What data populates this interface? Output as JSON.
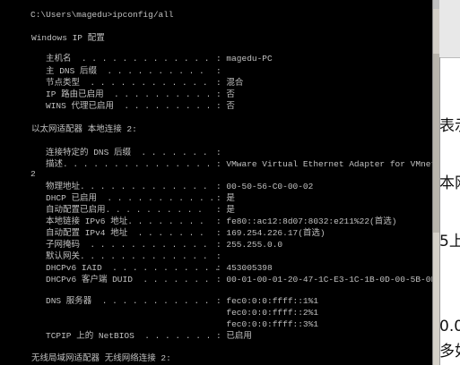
{
  "console": {
    "command_line": "C:\\Users\\magedu>ipconfig/all",
    "windows_ip_header": "Windows IP 配置",
    "host_rows": [
      {
        "key": "主机名  . . . . . . . . . . . . .",
        "value": ": magedu-PC"
      },
      {
        "key": "主 DNS 后缀  . . . . . . . . . .",
        "value": ":"
      },
      {
        "key": "节点类型  . . . . . . . . . . . .",
        "value": ": 混合"
      },
      {
        "key": "IP 路由已启用  . . . . . . . . . .",
        "value": ": 否"
      },
      {
        "key": "WINS 代理已启用  . . . . . . . . .",
        "value": ": 否"
      }
    ],
    "adapter1_header": "以太网适配器 本地连接 2:",
    "adapter1_rows": [
      {
        "key": "连接特定的 DNS 后缀  . . . . . . .",
        "value": ":"
      },
      {
        "key": "描述. . . . . . . . . . . . . . .",
        "value": ": VMware Virtual Ethernet Adapter for VMnet"
      },
      {
        "key": "物理地址. . . . . . . . . . . . .",
        "value": ": 00-50-56-C0-00-02"
      },
      {
        "key": "DHCP 已启用  . . . . . . . . . . .",
        "value": ": 是"
      },
      {
        "key": "自动配置已启用. . . . . . . . . .",
        "value": ": 是"
      },
      {
        "key": "本地链接 IPv6 地址. . . . . . . .",
        "value": ": fe80::ac12:8d07:8032:e211%22(首选)"
      },
      {
        "key": "自动配置 IPv4 地址  . . . . . . .",
        "value": ": 169.254.226.17(首选)"
      },
      {
        "key": "子网掩码  . . . . . . . . . . . .",
        "value": ": 255.255.0.0"
      },
      {
        "key": "默认网关. . . . . . . . . . . . .",
        "value": ":"
      },
      {
        "key": "DHCPv6 IAID  . . . . . . . . . . .",
        "value": ": 453005398"
      },
      {
        "key": "DHCPv6 客户端 DUID  . . . . . . .",
        "value": ": 00-01-00-01-20-47-1C-E3-1C-1B-0D-00-5B-0F"
      },
      {
        "key": "DNS 服务器  . . . . . . . . . . .",
        "value": ": fec0:0:0:ffff::1%1"
      },
      {
        "key": "",
        "value": "  fec0:0:0:ffff::2%1"
      },
      {
        "key": "",
        "value": "  fec0:0:0:ffff::3%1"
      },
      {
        "key": "TCPIP 上的 NetBIOS  . . . . . . .",
        "value": ": 已启用"
      }
    ],
    "wrap_char": "2",
    "adapter2_header": "无线局域网适配器 无线网络连接 2:"
  },
  "background_fragments": [
    "表示",
    "本网",
    "5上",
    "0.0",
    "多如"
  ]
}
